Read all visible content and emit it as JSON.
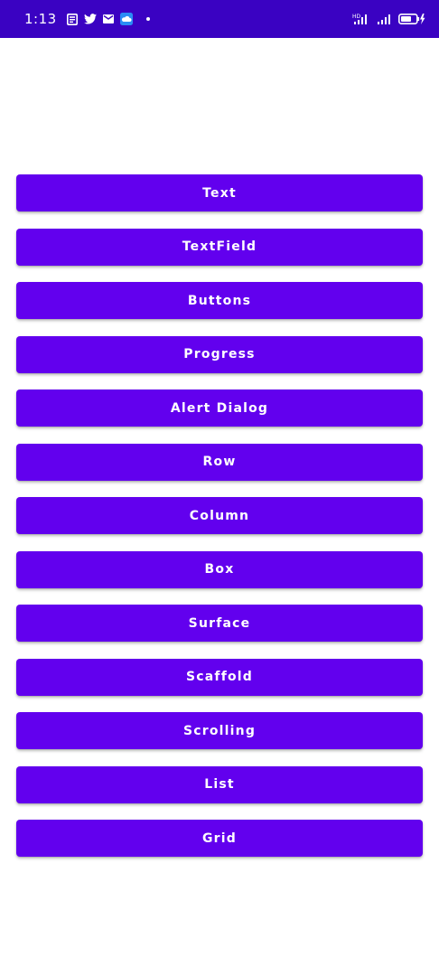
{
  "status_bar": {
    "time": "1:13",
    "background": "#3a02c2",
    "left_icons": [
      "news-icon",
      "twitter-icon",
      "mail-icon",
      "cloud-icon",
      "dot-icon"
    ],
    "right_icons": [
      "volte-signal-icon",
      "signal-icon",
      "battery-charging-icon"
    ],
    "volte_label": "HD"
  },
  "theme": {
    "button_color": "#6200ee",
    "button_text_color": "#ffffff",
    "page_background": "#ffffff"
  },
  "buttons": [
    {
      "label": "Text"
    },
    {
      "label": "TextField"
    },
    {
      "label": "Buttons"
    },
    {
      "label": "Progress"
    },
    {
      "label": "Alert Dialog"
    },
    {
      "label": "Row"
    },
    {
      "label": "Column"
    },
    {
      "label": "Box"
    },
    {
      "label": "Surface"
    },
    {
      "label": "Scaffold"
    },
    {
      "label": "Scrolling"
    },
    {
      "label": "List"
    },
    {
      "label": "Grid"
    }
  ]
}
